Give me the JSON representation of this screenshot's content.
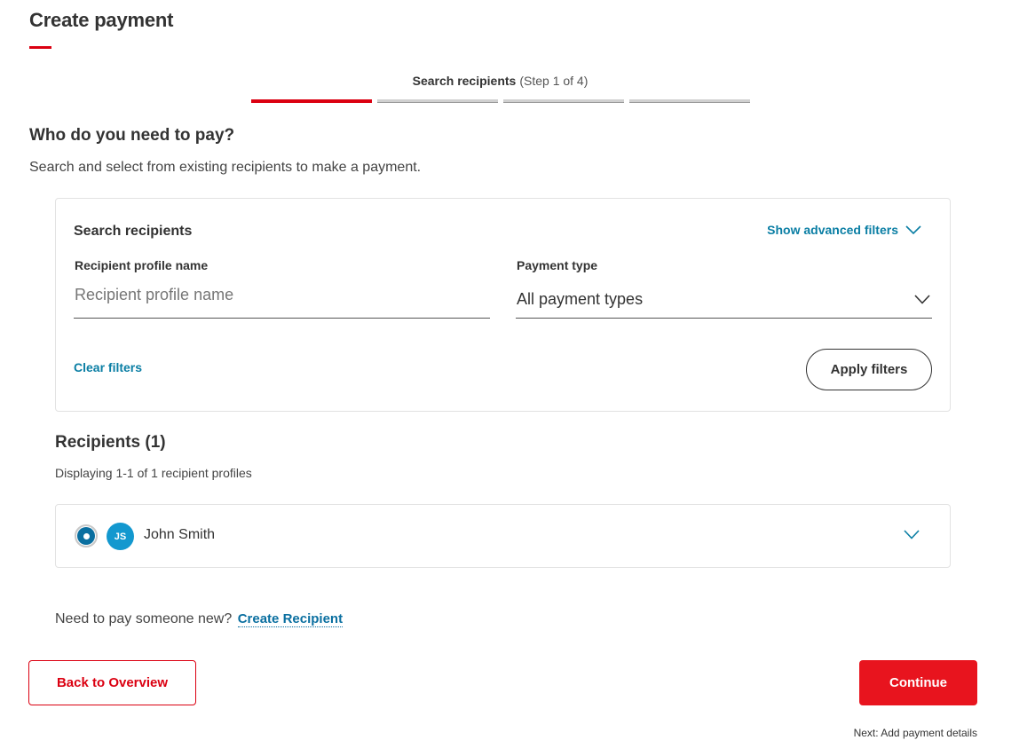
{
  "page": {
    "title": "Create payment"
  },
  "stepper": {
    "current_step": "Search recipients",
    "step_count": "(Step 1 of 4)",
    "total_steps": 4,
    "active_index": 0,
    "accent_color": "#db0011"
  },
  "intro": {
    "heading": "Who do you need to pay?",
    "subtext": "Search and select from existing recipients to make a payment."
  },
  "filters": {
    "title": "Search recipients",
    "advanced_label": "Show advanced filters",
    "advanced_icon": "chevron-down-icon",
    "name_label": "Recipient profile name",
    "name_placeholder": "Recipient profile name",
    "name_value": "",
    "payment_type_label": "Payment type",
    "payment_type_value": "All payment types",
    "clear_label": "Clear filters",
    "apply_label": "Apply filters"
  },
  "recipients": {
    "heading": "Recipients (1)",
    "count_text": "Displaying 1-1 of 1 recipient profiles",
    "items": [
      {
        "initials": "JS",
        "name": "John Smith",
        "selected": true,
        "avatar_color": "#1398cf"
      }
    ]
  },
  "footer": {
    "pay_new_text": "Need to pay someone new?",
    "create_link": "Create Recipient",
    "back_label": "Back to Overview",
    "continue_label": "Continue",
    "next_hint": "Next: Add payment details",
    "primary_color": "#e8141e",
    "link_color": "#0a7ea4"
  }
}
